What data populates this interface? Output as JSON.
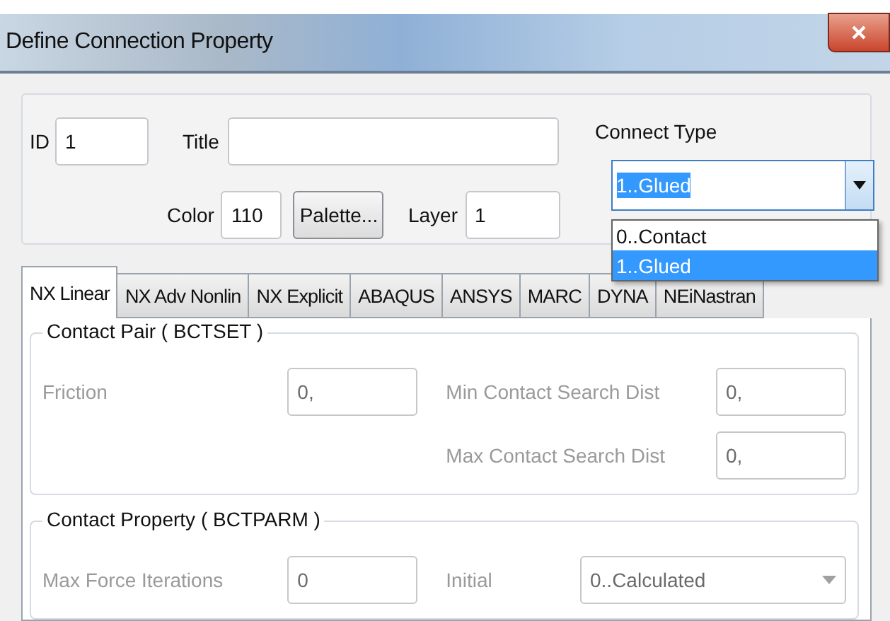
{
  "window": {
    "title": "Define Connection Property"
  },
  "id_field": {
    "label": "ID",
    "value": "1"
  },
  "title_field": {
    "label": "Title"
  },
  "color_field": {
    "label": "Color",
    "value": "110"
  },
  "palette_button": "Palette...",
  "layer_field": {
    "label": "Layer",
    "value": "1"
  },
  "connect_type": {
    "label": "Connect Type",
    "value": "1..Glued",
    "expanded": true,
    "options": [
      {
        "label": "0..Contact",
        "selected": false
      },
      {
        "label": "1..Glued",
        "selected": true
      }
    ]
  },
  "tabs": [
    {
      "label": "NX Linear",
      "selected": true
    },
    {
      "label": "NX Adv Nonlin",
      "selected": false
    },
    {
      "label": "NX Explicit",
      "selected": false
    },
    {
      "label": "ABAQUS",
      "selected": false
    },
    {
      "label": "ANSYS",
      "selected": false
    },
    {
      "label": "MARC",
      "selected": false
    },
    {
      "label": "DYNA",
      "selected": false
    },
    {
      "label": "NEiNastran",
      "selected": false
    }
  ],
  "groups": [
    {
      "title": "Contact Pair ( BCTSET )",
      "rows": [
        {
          "left": {
            "kind": "input",
            "label": "Friction",
            "value": "0,",
            "disabled": true
          },
          "right": {
            "kind": "input",
            "label": "Min Contact Search Dist",
            "value": "0,",
            "disabled": true
          }
        },
        {
          "right": {
            "kind": "input",
            "label": "Max Contact Search Dist",
            "value": "0,",
            "disabled": true
          }
        }
      ]
    },
    {
      "title": "Contact Property ( BCTPARM )",
      "rows": [
        {
          "left": {
            "kind": "input",
            "label": "Max Force Iterations",
            "value": "0",
            "disabled": true
          },
          "right": {
            "kind": "select",
            "label": "Initial",
            "value": "0..Calculated",
            "disabled": true
          }
        }
      ]
    }
  ]
}
